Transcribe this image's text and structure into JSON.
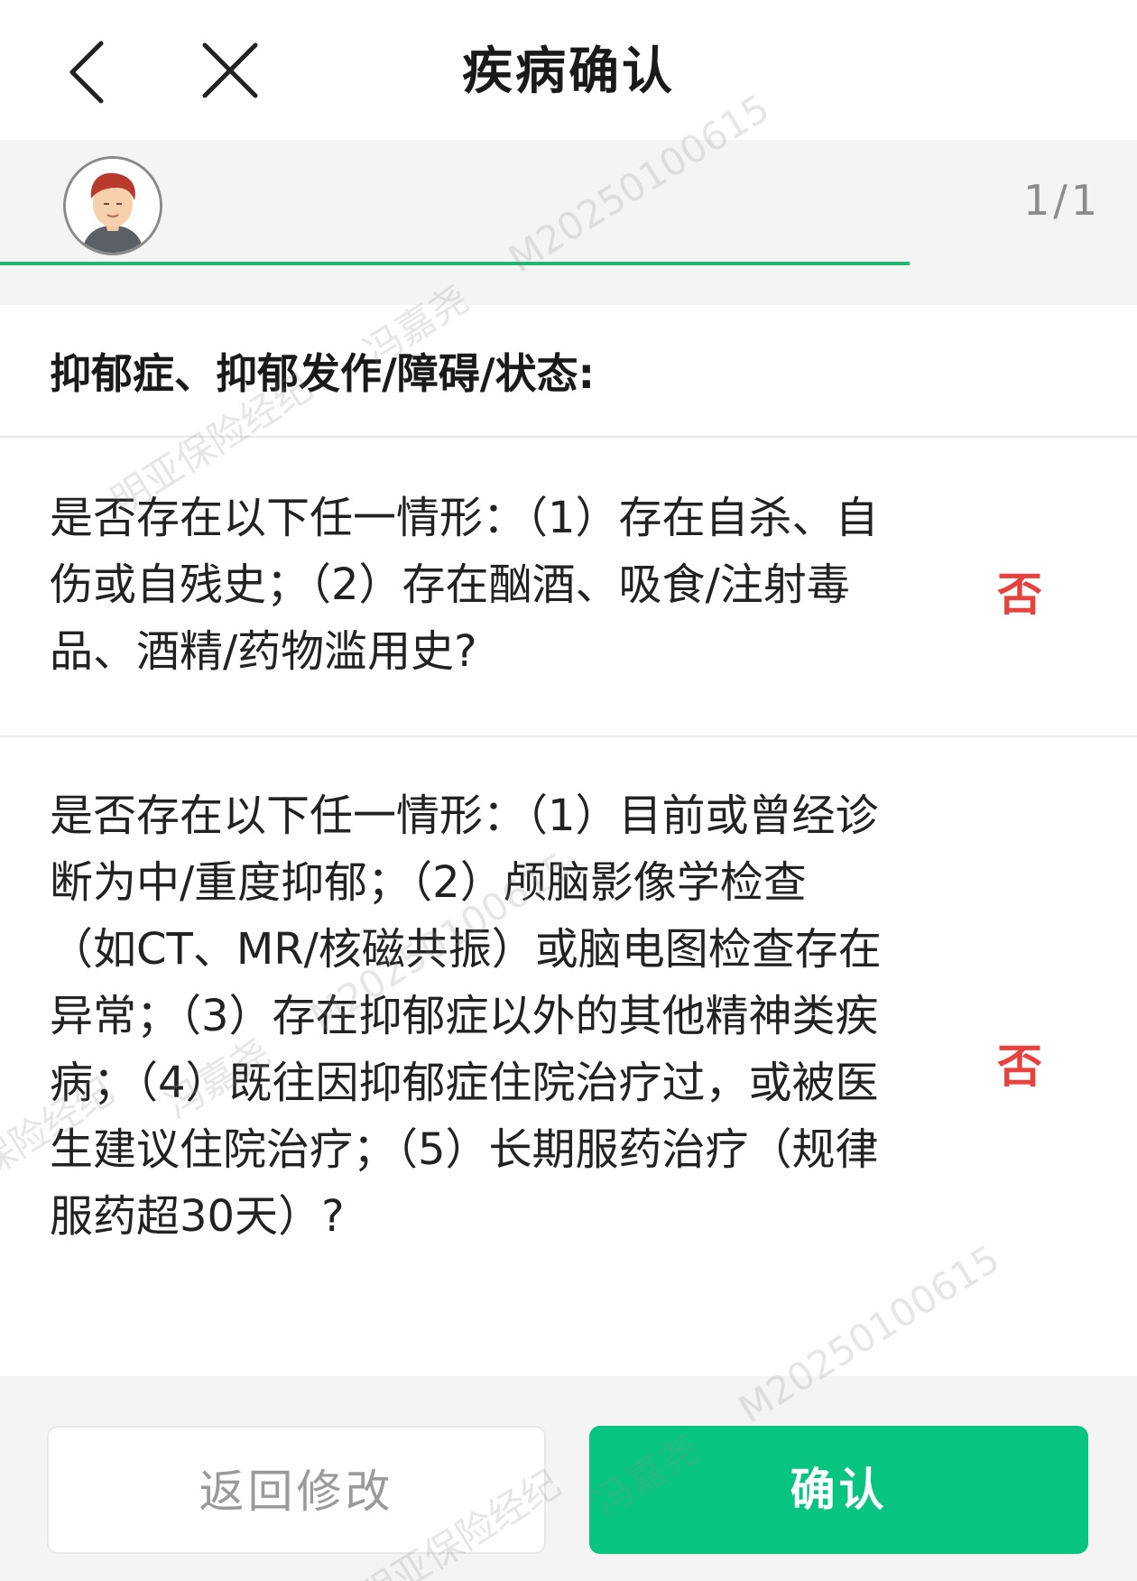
{
  "header": {
    "title": "疾病确认",
    "back_icon": "chevron-left-icon",
    "close_icon": "close-icon"
  },
  "person_strip": {
    "avatar_icon": "avatar-icon",
    "page_counter": "1/1",
    "accent_color": "#22b573"
  },
  "section": {
    "title": "抑郁症、抑郁发作/障碍/状态:"
  },
  "questions": [
    {
      "text": "是否存在以下任一情形：（1）存在自杀、自伤或自残史；（2）存在酗酒、吸食/注射毒品、酒精/药物滥用史?",
      "answer": "否"
    },
    {
      "text": "是否存在以下任一情形：（1）目前或曾经诊断为中/重度抑郁；（2）颅脑影像学检查（如CT、MR/核磁共振）或脑电图检查存在异常；（3）存在抑郁症以外的其他精神类疾病；（4）既往因抑郁症住院治疗过，或被医生建议住院治疗；（5）长期服药治疗（规律服药超30天）?",
      "answer": "否"
    }
  ],
  "footer": {
    "modify_label": "返回修改",
    "confirm_label": "确认",
    "confirm_color": "#07c480",
    "answer_color": "#e8423f"
  },
  "watermark": {
    "id_text": "M20250100615",
    "name_text": "冯嘉尧",
    "company_text": "明亚保险经纪"
  }
}
